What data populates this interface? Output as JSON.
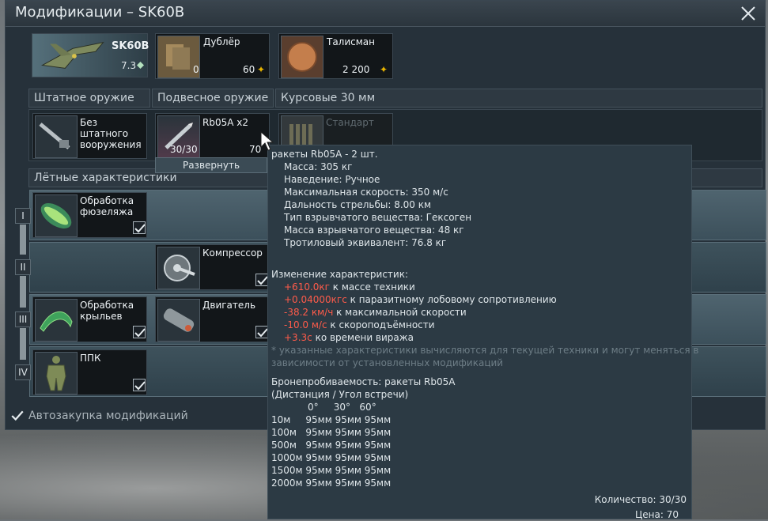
{
  "window": {
    "title": "Модификации – SK60B"
  },
  "vehicle": {
    "name": "SK60B",
    "br": "7.3"
  },
  "crew_cards": [
    {
      "name": "Дублёр",
      "count": "0",
      "price": "60"
    },
    {
      "name": "Талисман",
      "price": "2 200"
    }
  ],
  "sections": {
    "primary": "Штатное оружие",
    "secondary": "Подвесное оружие",
    "guns": "Курсовые 30 мм",
    "flight": "Лётные характеристики"
  },
  "weapons": {
    "primary_label": "Без штатного вооружения",
    "secondary_label": "Rb05A x2",
    "secondary_count": "30/30",
    "secondary_price": "70",
    "guns_label": "Стандарт",
    "expand_label": "Развернуть"
  },
  "tiers": [
    "I",
    "II",
    "III",
    "IV"
  ],
  "mods": {
    "fuselage": "Обработка фюзеляжа",
    "compressor": "Компрессор",
    "wings": "Обработка крыльев",
    "engine": "Двигатель",
    "gsuit": "ППК"
  },
  "auto_buy": "Автозакупка модификаций",
  "tooltip": {
    "title": "ракеты Rb05A - 2 шт.",
    "specs": [
      "Масса: 305 кг",
      "Наведение: Ручное",
      "Максимальная скорость: 350 м/с",
      "Дальность стрельбы: 8.00 км",
      "Тип взрывчатого вещества: Гексоген",
      "Масса взрывчатого вещества: 48 кг",
      "Тротиловый эквивалент: 76.8 кг"
    ],
    "changes_header": "Изменение характеристик:",
    "changes": [
      {
        "value": "+610.0кг",
        "text": " к массе техники"
      },
      {
        "value": "+0.04000кгс",
        "text": " к паразитному лобовому сопротивлению"
      },
      {
        "value": "-38.2 км/ч",
        "text": " к максимальной скорости"
      },
      {
        "value": "-10.0 м/с",
        "text": " к скороподъёмности"
      },
      {
        "value": "+3.3с",
        "text": " ко времени виража"
      }
    ],
    "note_line1": "* указанные характеристики вычисляются для текущей техники и могут меняться в",
    "note_line2": "зависимости от установленных модификаций",
    "pen_title": "Бронепробиваемость: ракеты Rb05A",
    "pen_subtitle": "(Дистанция / Угол встречи)",
    "pen_angles": "0°     30°   60°",
    "pen_rows": [
      "10м     95мм 95мм 95мм",
      "100м   95мм 95мм 95мм",
      "500м   95мм 95мм 95мм",
      "1000м 95мм 95мм 95мм",
      "1500м 95мм 95мм 95мм",
      "2000м 95мм 95мм 95мм"
    ],
    "quantity": "Количество: 30/30",
    "price": "Цена: 70"
  },
  "colors": {
    "accent_red": "#ff5b4a",
    "gold": "#e8b400",
    "window_bg": "#26313a"
  }
}
